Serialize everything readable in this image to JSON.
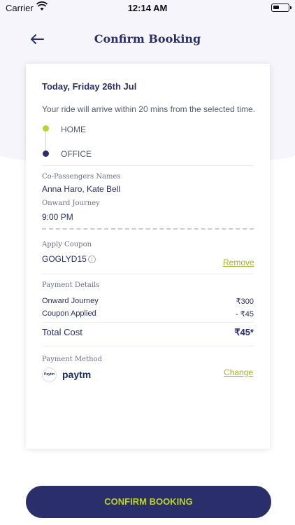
{
  "status_bar": {
    "carrier": "Carrier",
    "time": "12:14 AM"
  },
  "header": {
    "title": "Confirm Booking"
  },
  "booking": {
    "date": "Today, Friday 26th Jul",
    "arrival_note": "Your ride will arrive within 20 mins from the selected time.",
    "pickup": "HOME",
    "dropoff": "OFFICE",
    "co_passengers_label": "Co-Passengers Names",
    "co_passengers": "Anna Haro, Kate Bell",
    "onward_label": "Onward Journey",
    "onward_time": "9:00 PM"
  },
  "coupon": {
    "label": "Apply Coupon",
    "code": "GOGLYD15",
    "remove_label": "Remove"
  },
  "payment_details": {
    "label": "Payment Details",
    "rows": [
      {
        "label": "Onward Journey",
        "value": "₹300"
      },
      {
        "label": "Coupon Applied",
        "value": "- ₹45"
      }
    ],
    "total_label": "Total Cost",
    "total_value": "₹45*"
  },
  "payment_method": {
    "label": "Payment Method",
    "name": "paytm",
    "logo_text": "Paytm",
    "change_label": "Change"
  },
  "cta": {
    "label": "CONFIRM BOOKING"
  },
  "colors": {
    "primary": "#2a2f6b",
    "accent": "#bdd12f",
    "background_top": "#f5f5fb"
  }
}
